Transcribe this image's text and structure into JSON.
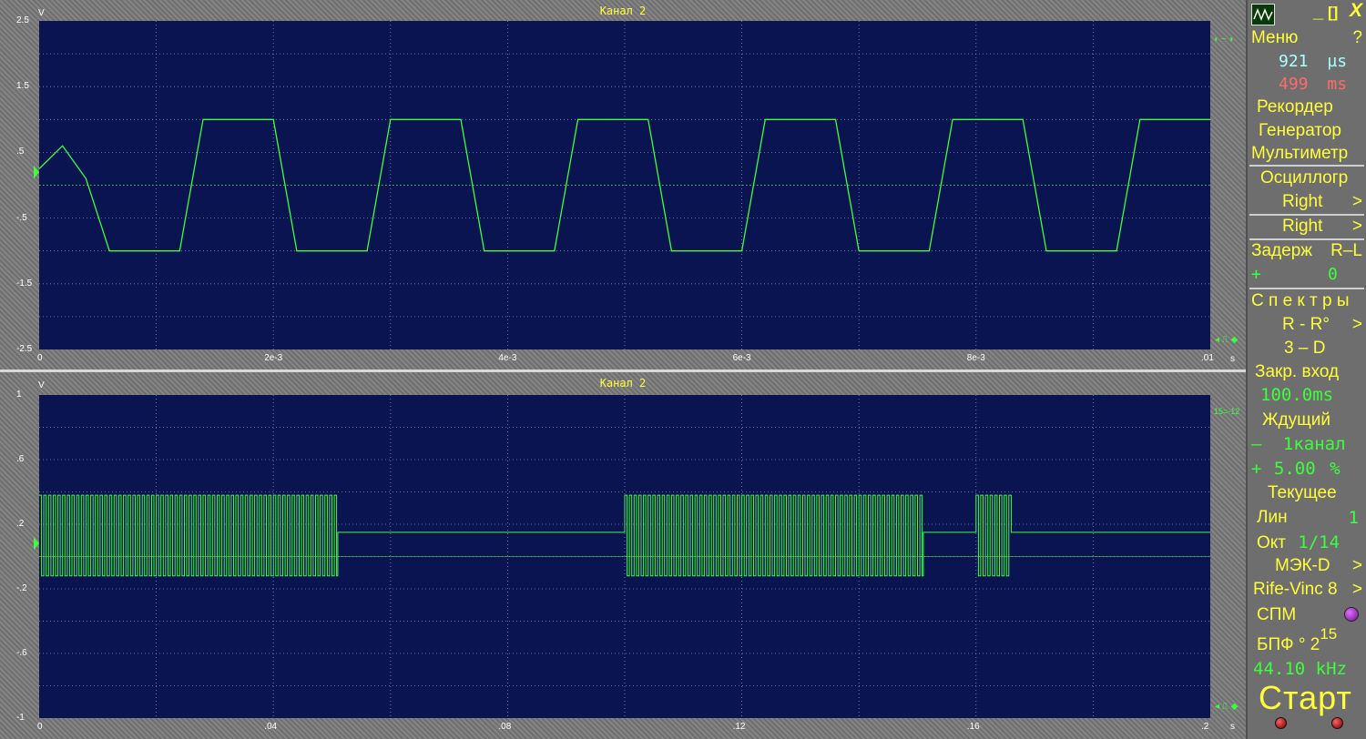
{
  "top_panel": {
    "title": "Канал 2",
    "y_unit": "V",
    "x_unit": "s",
    "y_ticks": [
      "2.5",
      "1.5",
      ".5",
      "-.5",
      "-1.5",
      "-2.5"
    ],
    "x_ticks": [
      "0",
      "2e-3",
      "4e-3",
      "6e-3",
      "8e-3",
      ".01"
    ],
    "right_marker_top": "◖ ~ ◗",
    "right_marker_bottom": "◂ ⎍ ◆"
  },
  "bottom_panel": {
    "title": "Канал 2",
    "y_unit": "V",
    "x_unit": "s",
    "y_ticks": [
      "1",
      ".6",
      ".2",
      "-.2",
      "-.6",
      "-1"
    ],
    "x_ticks": [
      "0",
      ".04",
      ".08",
      ".12",
      ".16",
      ".2"
    ],
    "right_marker_top": "15=-12",
    "right_marker_bottom": "◂ ⎍ ◆"
  },
  "chart_data": [
    {
      "type": "line",
      "title": "Канал 2",
      "ylabel": "V",
      "xlabel": "s",
      "xlim": [
        0,
        0.01
      ],
      "ylim": [
        -2.5,
        2.5
      ],
      "grid": true,
      "series": [
        {
          "x": [
            0,
            0.0002,
            0.0004,
            0.0006,
            0.0007,
            0.0008,
            0.0012,
            0.0014,
            0.0015,
            0.0016,
            0.002,
            0.0022,
            0.0023,
            0.0024,
            0.0028,
            0.003,
            0.0031,
            0.0032,
            0.0036,
            0.0038,
            0.0039,
            0.004,
            0.0044,
            0.0046,
            0.0047,
            0.0048,
            0.0052,
            0.0054,
            0.0055,
            0.0056,
            0.006,
            0.0062,
            0.0063,
            0.0064,
            0.0068,
            0.007,
            0.0071,
            0.0072,
            0.0076,
            0.0078,
            0.0079,
            0.008,
            0.0084,
            0.0086,
            0.0087,
            0.0088,
            0.0092,
            0.0094,
            0.0095,
            0.0096,
            0.01
          ],
          "y": [
            0.25,
            0.6,
            0.1,
            -1,
            -1,
            -1,
            -1,
            1,
            1,
            1,
            1,
            -1,
            -1,
            -1,
            -1,
            1,
            1,
            1,
            1,
            -1,
            -1,
            -1,
            -1,
            1,
            1,
            1,
            1,
            -1,
            -1,
            -1,
            -1,
            1,
            1,
            1,
            1,
            -1,
            -1,
            -1,
            -1,
            1,
            1,
            1,
            1,
            -1,
            -1,
            -1,
            -1,
            1,
            1,
            1,
            1
          ]
        }
      ]
    },
    {
      "type": "line",
      "title": "Канал 2",
      "ylabel": "V",
      "xlabel": "s",
      "xlim": [
        0,
        0.2
      ],
      "ylim": [
        -1,
        1
      ],
      "grid": true,
      "bursts": [
        [
          0.0,
          0.051
        ],
        [
          0.1,
          0.151
        ],
        [
          0.16,
          0.166
        ]
      ],
      "burst_high": 0.38,
      "burst_low": -0.12,
      "quiet_level": 0.15
    }
  ],
  "menu": {
    "items": {
      "menu": "Меню",
      "help": "?",
      "time1_value": "921",
      "time1_unit": "µs",
      "time2_value": "499",
      "time2_unit": "ms",
      "recorder": "Рекордер",
      "generator": "Генератор",
      "multimeter": "Мультиметр",
      "oscillograph": "Осциллогр",
      "right1": "Right",
      "right2": "Right",
      "delay": "Задерж",
      "delay_rl": "R–L",
      "delay_sign": "+",
      "delay_value": "0",
      "spectra": "С п е к т р ы",
      "r_r": "R - R°",
      "three_d": "3 – D",
      "closed_input": "Закр.  вход",
      "closed_value": "100.0",
      "closed_unit": "ms",
      "waiting": "Ждущий",
      "channel_sign": "–",
      "channel_num": "1",
      "channel_label": "канал",
      "level_sign": "+",
      "level_value": "5.00",
      "level_unit": "%",
      "current": "Текущее",
      "lin": "Лин",
      "lin_value": "1",
      "oct": "Окт",
      "oct_value": "1/14",
      "mek": "МЭК-D",
      "rife": "Rife-Vinc 8",
      "spm": "СПМ",
      "bpf": "БПФ °",
      "bpf_base": "2",
      "bpf_exp": "15",
      "rate": "44.10",
      "rate_unit": "kHz",
      "start": "Старт",
      "arrow": ">",
      "close": "X",
      "minimize": "_",
      "maximize": "[]"
    }
  },
  "colors": {
    "plot_bg": "#0a1450",
    "signal": "#3dff3d",
    "title": "#ffff40",
    "menu_yellow": "#ffff3a",
    "menu_green": "#3dff3d"
  }
}
